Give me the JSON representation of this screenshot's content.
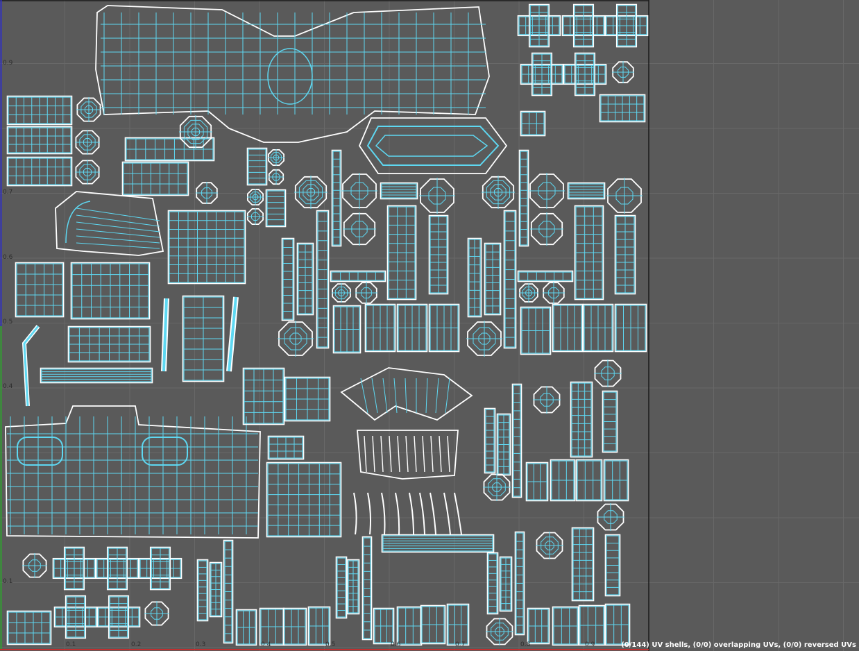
{
  "viewport": {
    "u_ticks": [
      "0.1",
      "0.2",
      "0.3",
      "0.4",
      "0.5",
      "0.6",
      "0.7",
      "0.8",
      "0.9"
    ],
    "v_ticks": [
      "0.9",
      "0.7",
      "0.6",
      "0.5",
      "0.4",
      "0.1"
    ],
    "colors": {
      "background": "#5a5a5a",
      "grid": "#686868",
      "shell_outline": "#ffffff",
      "edge": "#5ed8f2",
      "u_axis": "#c03030",
      "v_axis": "#30a030",
      "frame": "#1a1a1a"
    }
  },
  "status": {
    "text": "(0/144) UV shells, (0/0) overlapping UVs, (0/0) reversed UVs"
  }
}
